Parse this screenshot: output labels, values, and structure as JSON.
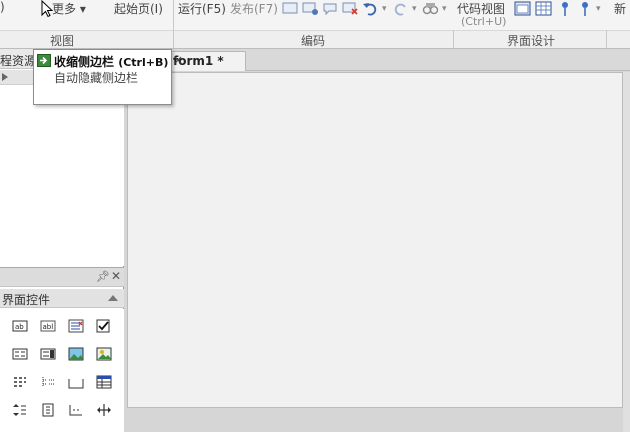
{
  "ribbon": {
    "more_label": "更多",
    "start_page_label": "起始页(I)",
    "run_label": "运行(F5)",
    "publish_label": "发布(F7)",
    "code_view_label": "代码视图",
    "code_view_shortcut": "(Ctrl+U)",
    "new_label": "新",
    "groups": {
      "view": "视图",
      "code": "编码",
      "ui_design": "界面设计"
    }
  },
  "left_panel": {
    "resources_tab": "程资源",
    "controls_header": "界面控件"
  },
  "doc_tab": {
    "label": "form1 *",
    "close": "×"
  },
  "tooltip": {
    "title": "收缩侧边栏",
    "shortcut": "(Ctrl+B)",
    "description": "自动隐藏侧边栏"
  },
  "icons": {
    "pin": "pin-icon",
    "close": "close-icon"
  }
}
